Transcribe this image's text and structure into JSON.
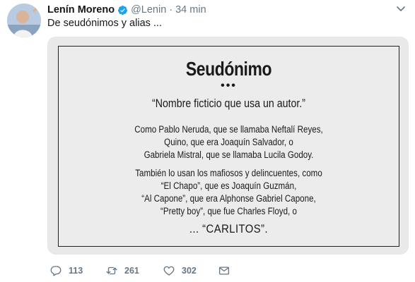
{
  "tweet": {
    "author_name": "Lenín Moreno",
    "handle": "@Lenin",
    "separator": "·",
    "time": "34 min",
    "text": "De seudónimos y alias ...",
    "verified": true,
    "icons": [
      "verified-badge-icon",
      "chevron-down-icon"
    ]
  },
  "image_card": {
    "title": "Seudónimo",
    "dots": "•••",
    "definition": "“Nombre ficticio que usa un autor.”",
    "paragraph1": [
      "Como Pablo Neruda, que se llamaba Neftalí Reyes,",
      "Quino, que era Joaquín Salvador, o",
      "Gabriela Mistral, que se llamaba Lucila Godoy."
    ],
    "paragraph2": [
      "También lo usan los mafiosos y delincuentes, como",
      "“El Chapo”, que es Joaquín Guzmán,",
      "“Al Capone”, que era Alphonse Gabriel Capone,",
      "“Pretty boy”, que fue Charles Floyd, o"
    ],
    "final_line": "... “CARLITOS”."
  },
  "actions": {
    "reply_count": "113",
    "retweet_count": "261",
    "like_count": "302",
    "icons": [
      "reply-icon",
      "retweet-icon",
      "heart-icon",
      "envelope-icon"
    ]
  },
  "colors": {
    "text": "#14171a",
    "secondary": "#657786",
    "verified": "#1da1f2",
    "card_background": "#ececec"
  }
}
